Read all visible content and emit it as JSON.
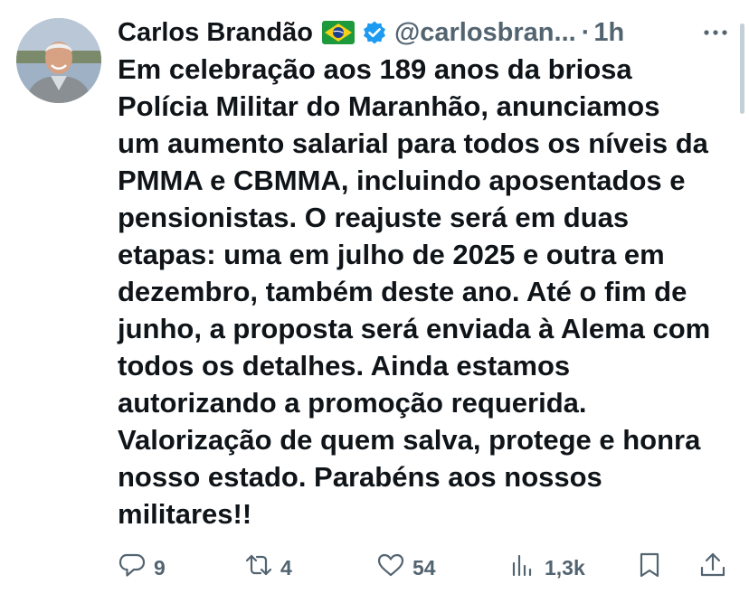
{
  "tweet": {
    "author": {
      "display_name": "Carlos Brandão",
      "flag_icon": "brazil-flag-icon",
      "verified_icon": "verified-badge-icon",
      "handle": "@carlosbran...",
      "separator": "·",
      "time": "1h"
    },
    "text_lines": [
      "Em celebração aos 189 anos da briosa",
      "Polícia Militar do Maranhão, anunciamos",
      "um aumento salarial para todos os níveis da",
      "PMMA e CBMMA, incluindo aposentados e",
      "pensionistas. O reajuste será em duas",
      "etapas: uma em julho de 2025 e outra em",
      "dezembro, também deste ano. Até o fim de",
      "junho, a proposta será enviada à Alema com",
      "todos os detalhes. Ainda estamos",
      "autorizando a promoção requerida.",
      "Valorização de quem salva, protege e honra",
      "nosso estado. Parabéns aos nossos",
      "militares!!"
    ],
    "actions": {
      "reply": {
        "icon": "reply-icon",
        "count": "9"
      },
      "retweet": {
        "icon": "retweet-icon",
        "count": "4"
      },
      "like": {
        "icon": "heart-icon",
        "count": "54"
      },
      "views": {
        "icon": "views-chart-icon",
        "count": "1,3k"
      },
      "bookmark": {
        "icon": "bookmark-icon"
      },
      "share": {
        "icon": "share-icon"
      }
    }
  },
  "colors": {
    "text": "#0f1419",
    "secondary": "#536471",
    "verified": "#1d9bf0"
  }
}
